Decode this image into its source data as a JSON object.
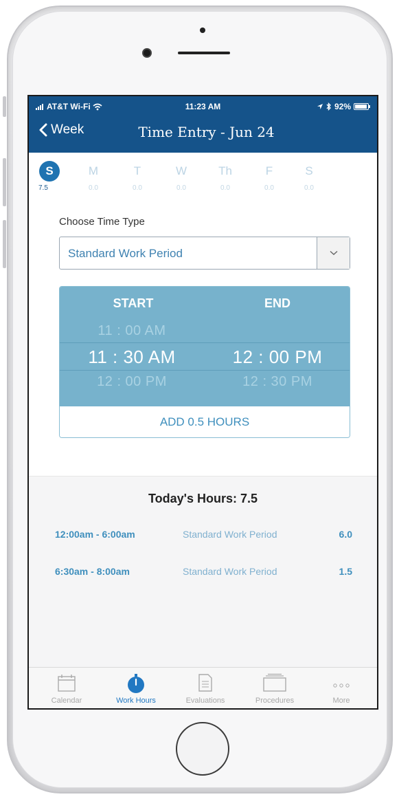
{
  "status_bar": {
    "carrier": "AT&T Wi-Fi",
    "time": "11:23 AM",
    "battery": "92%",
    "battery_level": 0.92
  },
  "nav": {
    "back_label": "Week",
    "title": "Time Entry - Jun 24"
  },
  "days": [
    {
      "letter": "S",
      "hours": "7.5",
      "active": true
    },
    {
      "letter": "M",
      "hours": "0.0",
      "active": false
    },
    {
      "letter": "T",
      "hours": "0.0",
      "active": false
    },
    {
      "letter": "W",
      "hours": "0.0",
      "active": false
    },
    {
      "letter": "Th",
      "hours": "0.0",
      "active": false
    },
    {
      "letter": "F",
      "hours": "0.0",
      "active": false
    },
    {
      "letter": "S",
      "hours": "0.0",
      "active": false
    }
  ],
  "time_type": {
    "label": "Choose Time Type",
    "selected": "Standard Work Period"
  },
  "picker": {
    "start_header": "START",
    "end_header": "END",
    "start_prev": "11 : 00  AM",
    "start_selected": "11 : 30  AM",
    "start_next": "12 : 00  PM",
    "end_selected": "12 : 00  PM",
    "end_next": "12 : 30  PM",
    "add_button": "ADD 0.5 HOURS"
  },
  "today": {
    "title": "Today's Hours: 7.5",
    "entries": [
      {
        "range": "12:00am - 6:00am",
        "type": "Standard Work Period",
        "hours": "6.0"
      },
      {
        "range": "6:30am - 8:00am",
        "type": "Standard Work Period",
        "hours": "1.5"
      }
    ]
  },
  "tabs": [
    {
      "label": "Calendar",
      "icon": "calendar-icon",
      "active": false
    },
    {
      "label": "Work Hours",
      "icon": "stopwatch-icon",
      "active": true
    },
    {
      "label": "Evaluations",
      "icon": "document-icon",
      "active": false
    },
    {
      "label": "Procedures",
      "icon": "folder-stack-icon",
      "active": false
    },
    {
      "label": "More",
      "icon": "more-icon",
      "active": false
    }
  ],
  "colors": {
    "header": "#15538a",
    "accent": "#1f73b1",
    "picker": "#77b2cc"
  }
}
